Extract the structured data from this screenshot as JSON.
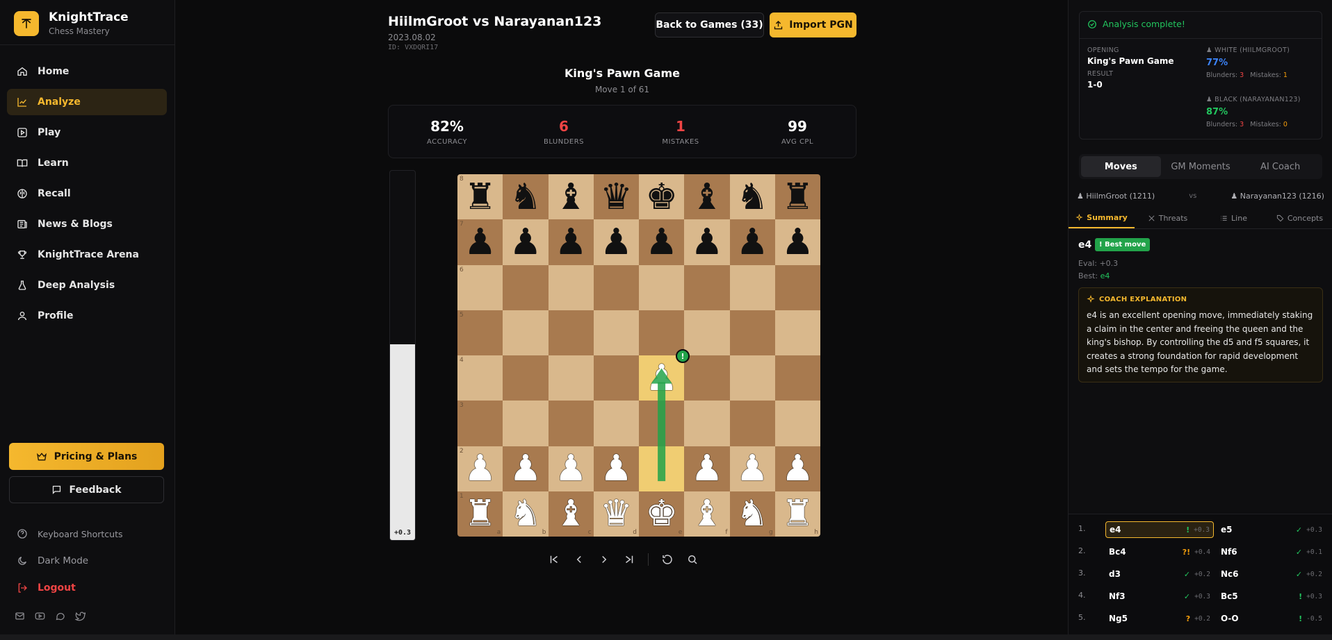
{
  "brand": {
    "title": "KnightTrace",
    "subtitle": "Chess Mastery"
  },
  "nav": [
    {
      "label": "Home",
      "icon": "home-icon",
      "active": false
    },
    {
      "label": "Analyze",
      "icon": "chart-line-icon",
      "active": true
    },
    {
      "label": "Play",
      "icon": "play-icon",
      "active": false
    },
    {
      "label": "Learn",
      "icon": "book-icon",
      "active": false
    },
    {
      "label": "Recall",
      "icon": "brain-icon",
      "active": false
    },
    {
      "label": "News & Blogs",
      "icon": "newspaper-icon",
      "active": false
    },
    {
      "label": "KnightTrace Arena",
      "icon": "trophy-icon",
      "active": false
    },
    {
      "label": "Deep Analysis",
      "icon": "flask-icon",
      "active": false
    },
    {
      "label": "Profile",
      "icon": "user-icon",
      "active": false
    }
  ],
  "sidebar_bottom": {
    "pricing": "Pricing & Plans",
    "feedback": "Feedback",
    "shortcuts": "Keyboard Shortcuts",
    "dark_mode": "Dark Mode",
    "logout": "Logout"
  },
  "game": {
    "title": "HiilmGroot vs Narayanan123",
    "date": "2023.08.02",
    "id": "ID: VXDQRI17",
    "back_label": "Back to Games (33)",
    "import_label": "Import PGN",
    "opening": "King's Pawn Game",
    "move_of": "Move 1 of 61"
  },
  "stats": [
    {
      "value": "82%",
      "label": "ACCURACY",
      "color": "#ffffff"
    },
    {
      "value": "6",
      "label": "BLUNDERS",
      "color": "#ef4444"
    },
    {
      "value": "1",
      "label": "MISTAKES",
      "color": "#ef4444"
    },
    {
      "value": "99",
      "label": "AVG CPL",
      "color": "#ffffff"
    }
  ],
  "eval": {
    "text": "+0.3",
    "white_fraction": 0.53
  },
  "board": {
    "light": "#d9b88c",
    "dark": "#a87a4f",
    "highlight": "#f0cd72",
    "ranks": [
      "8",
      "7",
      "6",
      "5",
      "4",
      "3",
      "2",
      "1"
    ],
    "files": [
      "a",
      "b",
      "c",
      "d",
      "e",
      "f",
      "g",
      "h"
    ],
    "position": [
      [
        "r",
        "n",
        "b",
        "q",
        "k",
        "b",
        "n",
        "r"
      ],
      [
        "p",
        "p",
        "p",
        "p",
        "p",
        "p",
        "p",
        "p"
      ],
      [
        "",
        "",
        "",
        "",
        "",
        "",
        "",
        ""
      ],
      [
        "",
        "",
        "",
        "",
        "",
        "",
        "",
        ""
      ],
      [
        "",
        "",
        "",
        "",
        "P",
        "",
        "",
        ""
      ],
      [
        "",
        "",
        "",
        "",
        "",
        "",
        "",
        ""
      ],
      [
        "P",
        "P",
        "P",
        "P",
        "",
        "P",
        "P",
        "P"
      ],
      [
        "R",
        "N",
        "B",
        "Q",
        "K",
        "B",
        "N",
        "R"
      ]
    ],
    "highlighted": [
      "e2",
      "e4"
    ],
    "arrow": {
      "from": "e2",
      "to": "e4",
      "color": "#22a34a"
    },
    "best_badge": "!"
  },
  "right": {
    "status": "Analysis complete!",
    "opening_label": "OPENING",
    "opening_value": "King's Pawn Game",
    "result_label": "RESULT",
    "result_value": "1-0",
    "white_label": "WHITE (HIILMGROOT)",
    "white_accuracy": "77%",
    "white_blunders_label": "Blunders:",
    "white_blunders": "3",
    "white_mistakes_label": "Mistakes:",
    "white_mistakes": "1",
    "black_label": "BLACK (NARAYANAN123)",
    "black_accuracy": "87%",
    "black_blunders_label": "Blunders:",
    "black_blunders": "3",
    "black_mistakes_label": "Mistakes:",
    "black_mistakes": "0",
    "tabs": [
      "Moves",
      "GM Moments",
      "AI Coach"
    ],
    "player_white": "HiilmGroot (1211)",
    "vs": "vs",
    "player_black": "Narayanan123 (1216)",
    "sub_tabs": [
      "Summary",
      "Threats",
      "Line",
      "Concepts"
    ],
    "move": "e4",
    "best_tag": "! Best move",
    "eval_line": "Eval: +0.3",
    "best_prefix": "Best: ",
    "best_move": "e4",
    "coach_title": "COACH EXPLANATION",
    "coach_text": "e4 is an excellent opening move, immediately staking a claim in the center and freeing the queen and the king's bishop. By controlling the d5 and f5 squares, it creates a strong foundation for rapid development and sets the tempo for the game."
  },
  "moves": [
    {
      "num": "1.",
      "white": "e4",
      "w_sym": "!",
      "w_col": "#22c55e",
      "w_eval": "+0.3",
      "black": "e5",
      "b_sym": "✓",
      "b_col": "#22c55e",
      "b_eval": "+0.3"
    },
    {
      "num": "2.",
      "white": "Bc4",
      "w_sym": "?!",
      "w_col": "#f59e0b",
      "w_eval": "+0.4",
      "black": "Nf6",
      "b_sym": "✓",
      "b_col": "#22c55e",
      "b_eval": "+0.1"
    },
    {
      "num": "3.",
      "white": "d3",
      "w_sym": "✓",
      "w_col": "#22c55e",
      "w_eval": "+0.2",
      "black": "Nc6",
      "b_sym": "✓",
      "b_col": "#22c55e",
      "b_eval": "+0.2"
    },
    {
      "num": "4.",
      "white": "Nf3",
      "w_sym": "✓",
      "w_col": "#22c55e",
      "w_eval": "+0.3",
      "black": "Bc5",
      "b_sym": "!",
      "b_col": "#22c55e",
      "b_eval": "+0.3"
    },
    {
      "num": "5.",
      "white": "Ng5",
      "w_sym": "?",
      "w_col": "#f59e0b",
      "w_eval": "+0.2",
      "black": "O-O",
      "b_sym": "!",
      "b_col": "#22c55e",
      "b_eval": "-0.5"
    }
  ]
}
